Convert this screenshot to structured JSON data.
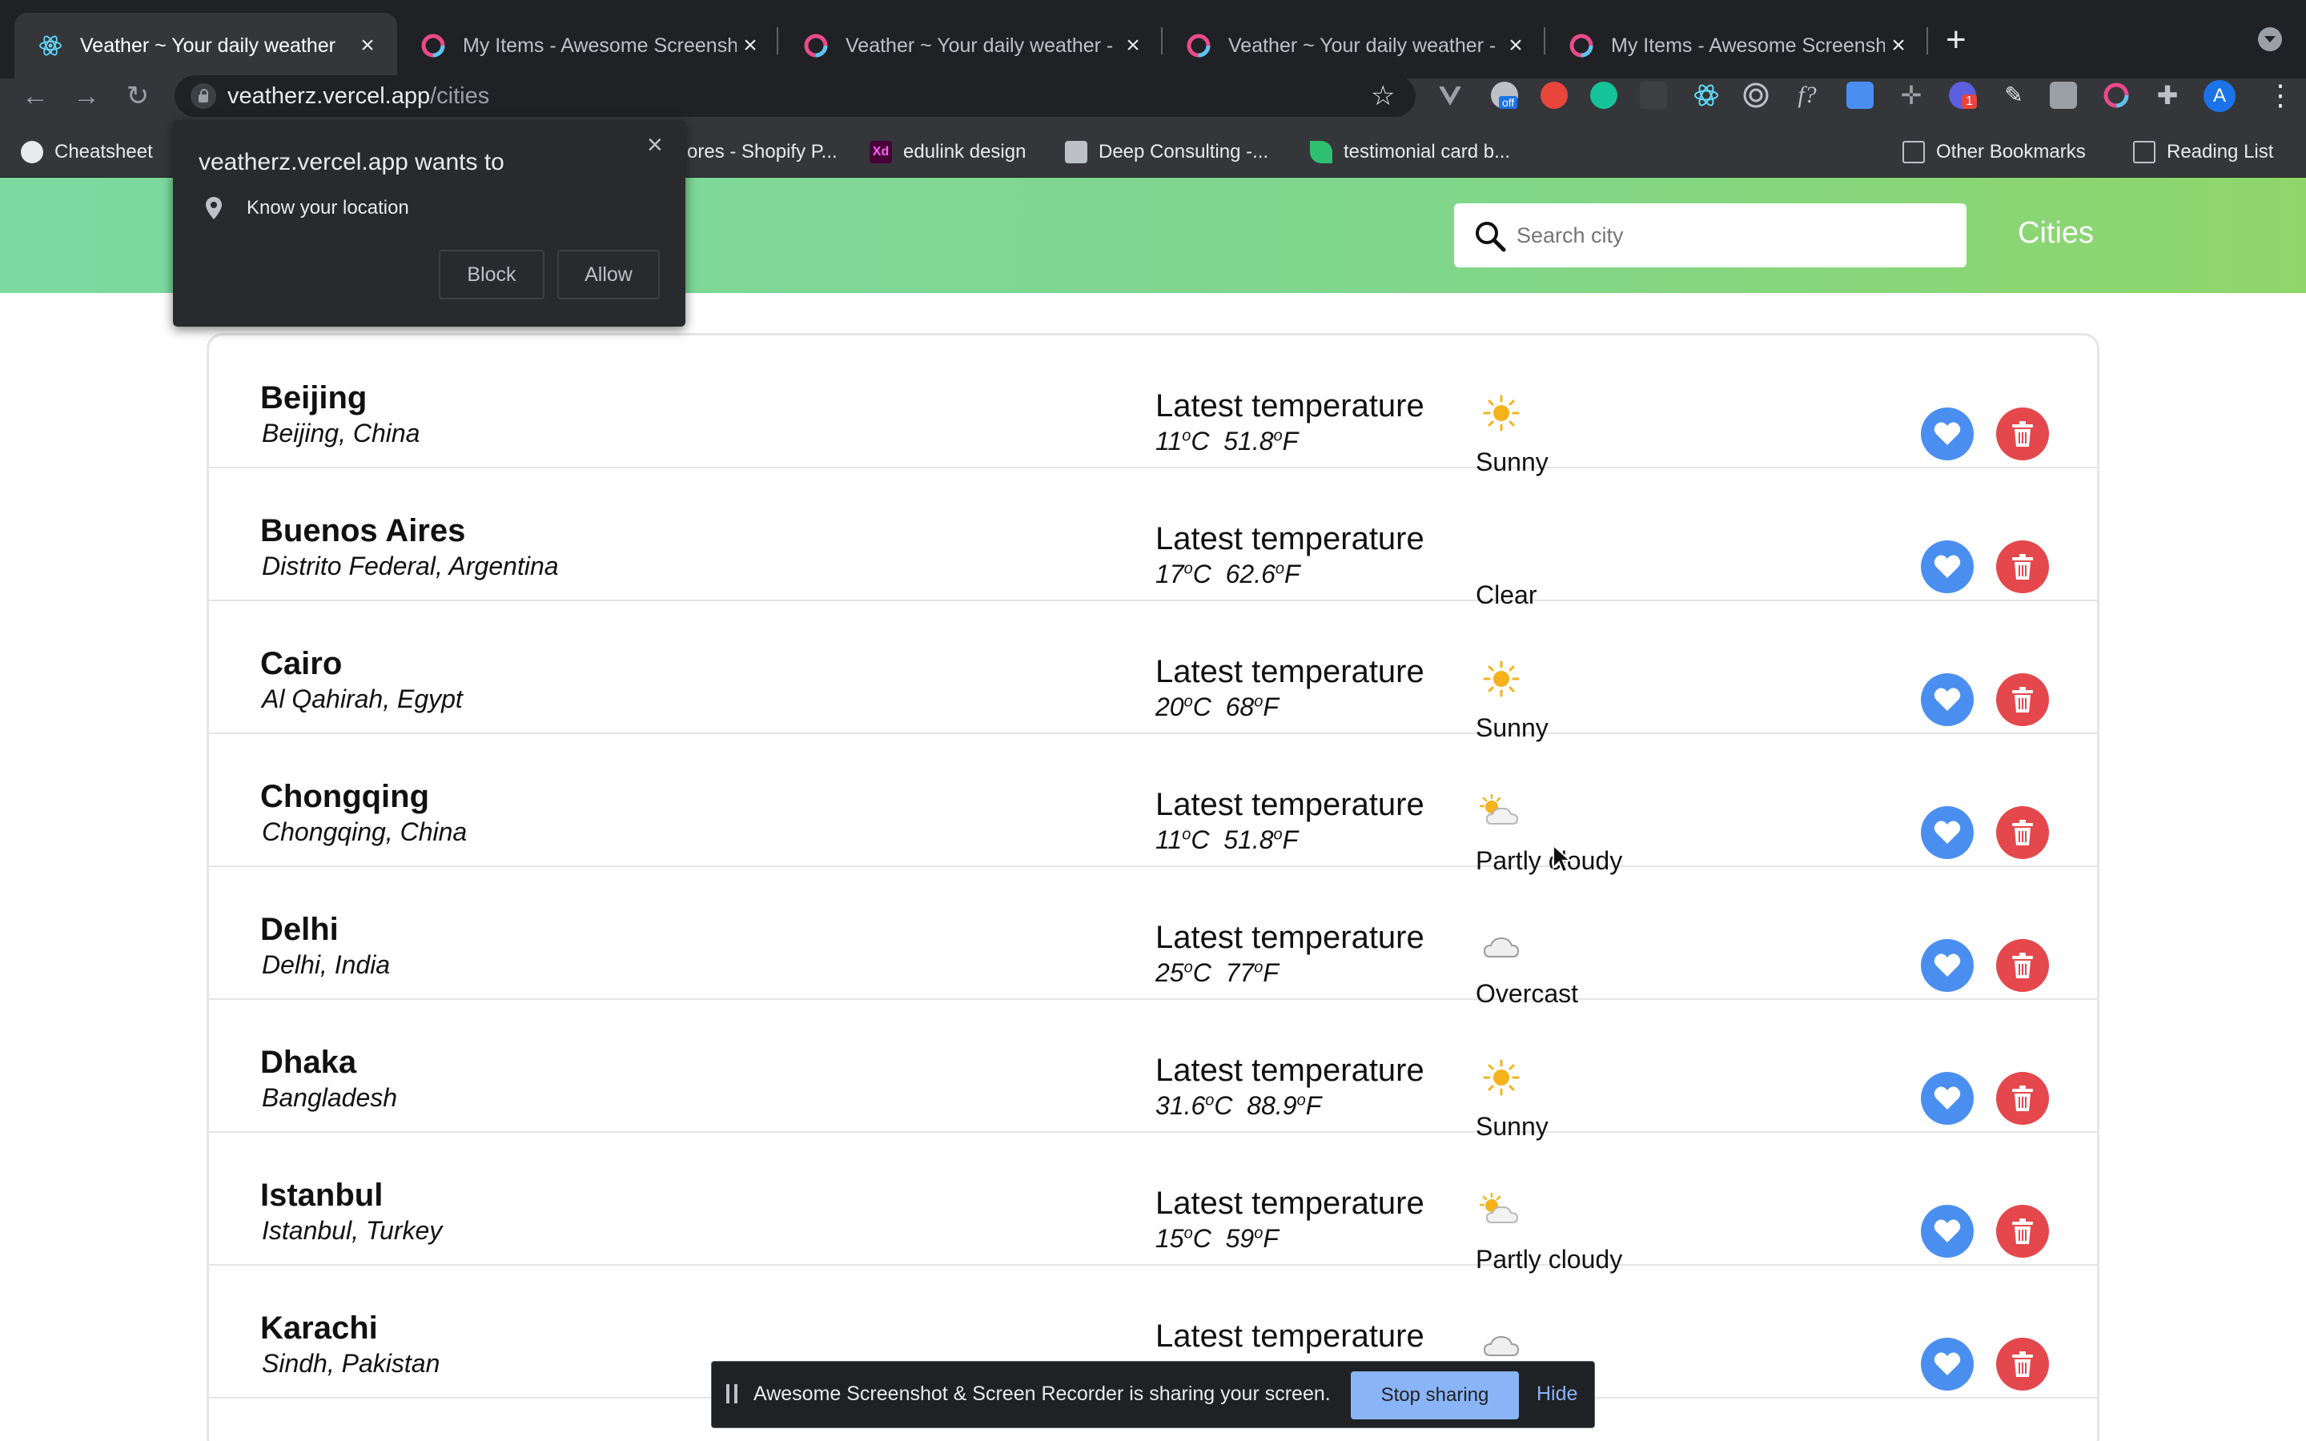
{
  "browser": {
    "tabs": [
      {
        "title": "Veather ~ Your daily weather",
        "active": true,
        "favicon": "react-icon"
      },
      {
        "title": "My Items - Awesome Screensh",
        "active": false,
        "favicon": "awesome-screenshot-icon"
      },
      {
        "title": "Veather ~ Your daily weather -",
        "active": false,
        "favicon": "awesome-screenshot-icon"
      },
      {
        "title": "Veather ~ Your daily weather -",
        "active": false,
        "favicon": "awesome-screenshot-icon"
      },
      {
        "title": "My Items - Awesome Screensh",
        "active": false,
        "favicon": "awesome-screenshot-icon"
      }
    ],
    "new_tab": "+",
    "url_host": "veatherz.vercel.app",
    "url_path": "/cities",
    "bookmarks": [
      {
        "label": "Cheatsheet",
        "icon": "github-icon"
      },
      {
        "label": "ores - Shopify P...",
        "icon": "shopify-icon"
      },
      {
        "label": "edulink design",
        "icon": "xd-icon"
      },
      {
        "label": "Deep Consulting -...",
        "icon": "doc-icon"
      },
      {
        "label": "testimonial card b...",
        "icon": "leaf-icon"
      },
      {
        "label": "Other Bookmarks",
        "icon": "folder-icon"
      },
      {
        "label": "Reading List",
        "icon": "reading-list-icon"
      }
    ],
    "avatar_letter": "A",
    "extension_badge": "1",
    "extension_off_badge": "off"
  },
  "permission_popup": {
    "title": "veatherz.vercel.app wants to",
    "item": "Know your location",
    "block_label": "Block",
    "allow_label": "Allow"
  },
  "header": {
    "search_placeholder": "Search city",
    "nav_link": "Cities"
  },
  "cities": [
    {
      "name": "Beijing",
      "region": "Beijing, China",
      "temp_label": "Latest temperature",
      "celsius": "11",
      "fahrenheit": "51.8",
      "condition": "Sunny",
      "icon": "sunny"
    },
    {
      "name": "Buenos Aires",
      "region": "Distrito Federal, Argentina",
      "temp_label": "Latest temperature",
      "celsius": "17",
      "fahrenheit": "62.6",
      "condition": "Clear",
      "icon": "clear-night"
    },
    {
      "name": "Cairo",
      "region": "Al Qahirah, Egypt",
      "temp_label": "Latest temperature",
      "celsius": "20",
      "fahrenheit": "68",
      "condition": "Sunny",
      "icon": "sunny"
    },
    {
      "name": "Chongqing",
      "region": "Chongqing, China",
      "temp_label": "Latest temperature",
      "celsius": "11",
      "fahrenheit": "51.8",
      "condition": "Partly cloudy",
      "icon": "partly-cloudy"
    },
    {
      "name": "Delhi",
      "region": "Delhi, India",
      "temp_label": "Latest temperature",
      "celsius": "25",
      "fahrenheit": "77",
      "condition": "Overcast",
      "icon": "overcast"
    },
    {
      "name": "Dhaka",
      "region": "Bangladesh",
      "temp_label": "Latest temperature",
      "celsius": "31.6",
      "fahrenheit": "88.9",
      "condition": "Sunny",
      "icon": "sunny"
    },
    {
      "name": "Istanbul",
      "region": "Istanbul, Turkey",
      "temp_label": "Latest temperature",
      "celsius": "15",
      "fahrenheit": "59",
      "condition": "Partly cloudy",
      "icon": "partly-cloudy"
    },
    {
      "name": "Karachi",
      "region": "Sindh, Pakistan",
      "temp_label": "Latest temperature",
      "celsius": "",
      "fahrenheit": "",
      "condition": "",
      "icon": "overcast"
    }
  ],
  "share_bar": {
    "message": "Awesome Screenshot & Screen Recorder is sharing your screen.",
    "stop_label": "Stop sharing",
    "hide_label": "Hide"
  },
  "colors": {
    "header_gradient_start": "#7cd9a0",
    "header_gradient_end": "#8fd66a",
    "favorite_button": "#4a8ff0",
    "delete_button": "#e4484c",
    "sun": "#f5b21b"
  }
}
